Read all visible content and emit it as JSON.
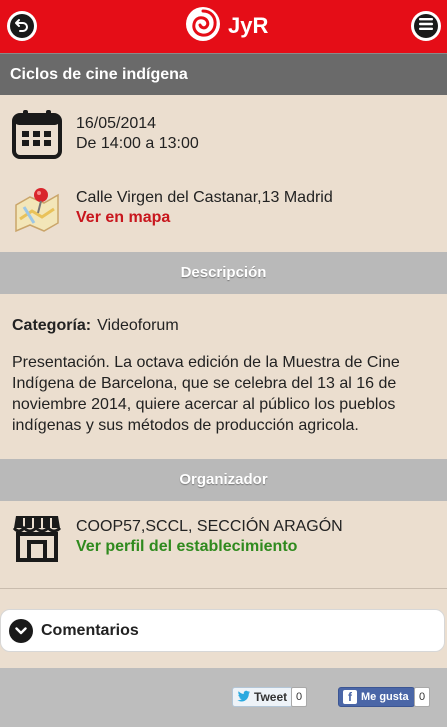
{
  "header": {
    "app_name": "JyR",
    "back_icon": "back-arrow-icon",
    "menu_icon": "menu-icon",
    "brand_color": "#e50d17"
  },
  "event": {
    "title": "Ciclos de cine indígena",
    "date": "16/05/2014",
    "time": "De 14:00 a 13:00",
    "address": "Calle Virgen del Castanar,13 Madrid",
    "map_link": "Ver en mapa"
  },
  "description": {
    "heading": "Descripción",
    "category_label": "Categoría:",
    "category_value": "Videoforum",
    "text": "Presentación. La octava edición de la Muestra de Cine Indígena de Barcelona, que se celebra del 13 al 16 de noviembre 2014, quiere acercar al público los pueblos indígenas y sus métodos de producción agricola."
  },
  "organizer": {
    "heading": "Organizador",
    "name": "COOP57,SCCL, SECCIÓN ARAGÓN",
    "profile_link": "Ver perfil del establecimiento"
  },
  "comments": {
    "label": "Comentarios"
  },
  "social": {
    "tweet_label": "Tweet",
    "tweet_count": "0",
    "like_label": "Me gusta",
    "like_count": "0"
  }
}
